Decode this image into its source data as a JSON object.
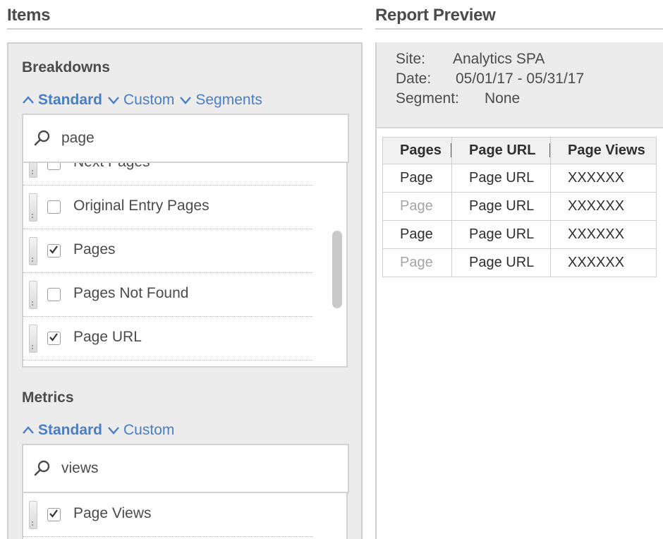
{
  "items": {
    "title": "Items",
    "breakdowns": {
      "title": "Breakdowns",
      "tabs": [
        "Standard",
        "Custom",
        "Segments"
      ],
      "search_value": "page",
      "rows": [
        {
          "label": "Next Pages",
          "checked": false
        },
        {
          "label": "Original Entry Pages",
          "checked": false
        },
        {
          "label": "Pages",
          "checked": true
        },
        {
          "label": "Pages Not Found",
          "checked": false
        },
        {
          "label": "Page URL",
          "checked": true
        }
      ]
    },
    "metrics": {
      "title": "Metrics",
      "tabs": [
        "Standard",
        "Custom"
      ],
      "search_value": "views",
      "rows": [
        {
          "label": "Page Views",
          "checked": true
        }
      ]
    }
  },
  "preview": {
    "title": "Report Preview",
    "site_label": "Site:",
    "site_value": "Analytics SPA",
    "date_label": "Date:",
    "date_value": "05/01/17 - 05/31/17",
    "segment_label": "Segment:",
    "segment_value": "None",
    "table": {
      "headers": [
        "Pages",
        "Page URL",
        "Page Views"
      ],
      "rows": [
        [
          "Page",
          "Page URL",
          "XXXXXX"
        ],
        [
          "Page",
          "Page URL",
          "XXXXXX"
        ],
        [
          "Page",
          "Page URL",
          "XXXXXX"
        ],
        [
          "Page",
          "Page URL",
          "XXXXXX"
        ]
      ]
    }
  },
  "colors": {
    "accent": "#4a7ec2",
    "panel_bg": "#ececec"
  }
}
